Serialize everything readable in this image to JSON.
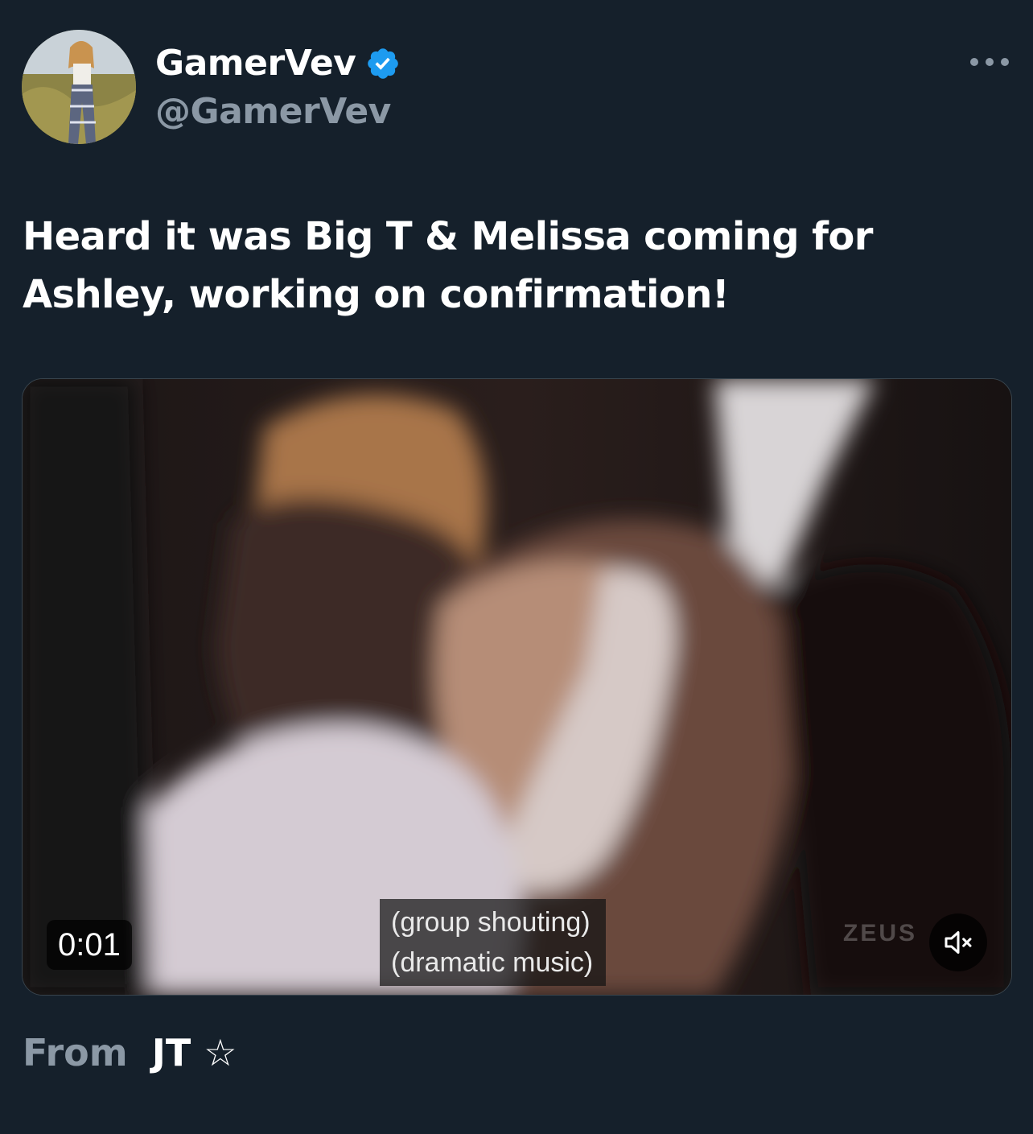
{
  "author": {
    "display_name": "GamerVev",
    "handle": "@GamerVev",
    "verified": true,
    "verified_color": "#1d9bf0"
  },
  "more_icon": "more-horizontal-icon",
  "tweet": {
    "text": "Heard it was Big T & Melissa coming for Ashley, working on confirmation!"
  },
  "media": {
    "type": "video",
    "timestamp": "0:01",
    "captions": [
      "(group shouting)",
      "(dramatic music)"
    ],
    "watermark": "ZEUS",
    "mute_icon": "volume-muted-icon"
  },
  "source": {
    "prefix": "From",
    "name": "JT ☆"
  },
  "colors": {
    "background": "#15202b",
    "secondary_text": "#8b98a5",
    "primary_text": "#ffffff"
  }
}
